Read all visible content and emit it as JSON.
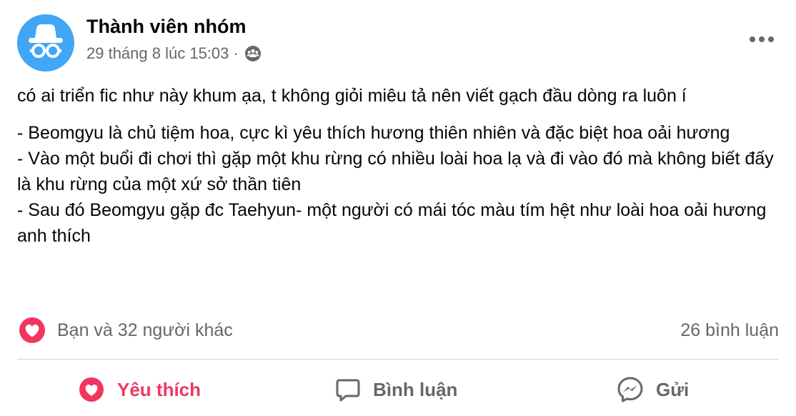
{
  "post": {
    "author": "Thành viên nhóm",
    "timestamp": "29 tháng 8 lúc 15:03",
    "separator": "·",
    "privacy_icon": "group-members-icon",
    "avatar_icon": "anonymous-incognito-icon",
    "content": {
      "intro": "có ai triển fic như này khum ạa, t không giỏi miêu tả nên viết gạch đầu dòng ra luôn í",
      "bullets": [
        "- Beomgyu là chủ tiệm hoa, cực kì yêu thích hương thiên nhiên và đặc biệt hoa oải hương",
        "- Vào một buổi đi chơi thì gặp một khu rừng có nhiều loài hoa lạ và đi vào đó mà không biết đấy là khu rừng của một xứ sở thần tiên",
        "- Sau đó Beomgyu gặp đc Taehyun- một người có mái tóc màu tím hệt như loài hoa oải hương anh thích"
      ]
    },
    "reactions": {
      "icon": "love-reaction-icon",
      "summary": "Bạn và 32 người khác"
    },
    "comments_count": "26 bình luận"
  },
  "actions": {
    "like_label": "Yêu thích",
    "comment_label": "Bình luận",
    "share_label": "Gửi"
  },
  "colors": {
    "avatar_bg": "#40a6f5",
    "love_red": "#f0365e",
    "secondary_text": "#65676b",
    "divider": "#ced0d4"
  }
}
